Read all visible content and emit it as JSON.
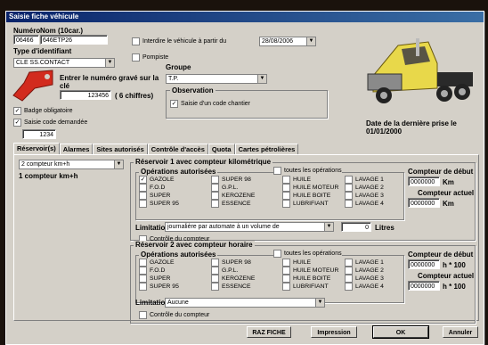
{
  "window": {
    "title": "Saisie fiche véhicule"
  },
  "header": {
    "numero_label": "Numéro",
    "numero_value": "06466",
    "nom_label": "Nom (10car.)",
    "nom_value": "646ETP26",
    "type_ident_label": "Type d'identifiant",
    "type_ident_value": "CLE SS.CONTACT",
    "code_label": "Entrer le numéro gravé sur la clé",
    "code_value": "123456",
    "code_hint": "( 6 chiffres)",
    "badge_label": "Badge obligatoire",
    "badge_checked": true,
    "saisie_code_label": "Saisie code demandée",
    "saisie_code_checked": true,
    "saisie_code_value": "1234",
    "interdire_label": "Interdire le véhicule à partir du",
    "interdire_checked": false,
    "interdire_date": "28/08/2006",
    "pompiste_label": "Pompiste",
    "pompiste_checked": false,
    "groupe_label": "Groupe",
    "groupe_value": "T.P.",
    "observation_label": "Observation",
    "obs_chantier_label": "Saisie d'un code chantier",
    "obs_chantier_checked": true,
    "last_photo_label": "Date de la dernière prise le",
    "last_photo_date": "01/01/2000"
  },
  "tabs": [
    "Réservoir(s)",
    "Alarmes",
    "Sites autorisés",
    "Contrôle d'accès",
    "Quota",
    "Cartes pétrolières"
  ],
  "reservoir_panel": {
    "compteur_select": "2 compteur km+h",
    "compteur_summary": "1 compteur km+h"
  },
  "reservoir1": {
    "title": "Réservoir 1 avec compteur kilométrique",
    "ops_label": "Opérations autorisées",
    "toutes_label": "toutes les opérations",
    "operations": [
      {
        "label": "GAZOLE",
        "checked": true
      },
      {
        "label": "SUPER 98",
        "checked": false
      },
      {
        "label": "HUILE",
        "checked": false
      },
      {
        "label": "LAVAGE 1",
        "checked": false
      },
      {
        "label": "F.O.D",
        "checked": false
      },
      {
        "label": "G.P.L.",
        "checked": false
      },
      {
        "label": "HUILE MOTEUR",
        "checked": false
      },
      {
        "label": "LAVAGE 2",
        "checked": false
      },
      {
        "label": "SUPER",
        "checked": false
      },
      {
        "label": "KEROZENE",
        "checked": false
      },
      {
        "label": "HUILE BOITE",
        "checked": false
      },
      {
        "label": "LAVAGE 3",
        "checked": false
      },
      {
        "label": "SUPER 95",
        "checked": false
      },
      {
        "label": "ESSENCE",
        "checked": false
      },
      {
        "label": "LUBRIFIANT",
        "checked": false
      },
      {
        "label": "LAVAGE 4",
        "checked": false
      }
    ],
    "compteur_debut_label": "Compteur de début",
    "compteur_debut_value": "0000000",
    "compteur_debut_unit": "Km",
    "compteur_actuel_label": "Compteur actuel",
    "compteur_actuel_value": "0000000",
    "compteur_actuel_unit": "Km",
    "limitation_label": "Limitation",
    "limitation_value": "journalière par automate  à un volume de",
    "limitation_qty": "0",
    "limitation_unit": "Litres",
    "controle_label": "Contrôle du compteur"
  },
  "reservoir2": {
    "title": "Réservoir 2 avec compteur horaire",
    "ops_label": "Opérations autorisées",
    "toutes_label": "toutes les opérations",
    "operations": [
      {
        "label": "GAZOLE",
        "checked": false
      },
      {
        "label": "SUPER 98",
        "checked": false
      },
      {
        "label": "HUILE",
        "checked": false
      },
      {
        "label": "LAVAGE 1",
        "checked": false
      },
      {
        "label": "F.O.D",
        "checked": false
      },
      {
        "label": "G.P.L.",
        "checked": false
      },
      {
        "label": "HUILE MOTEUR",
        "checked": false
      },
      {
        "label": "LAVAGE 2",
        "checked": false
      },
      {
        "label": "SUPER",
        "checked": false
      },
      {
        "label": "KEROZENE",
        "checked": false
      },
      {
        "label": "HUILE BOITE",
        "checked": false
      },
      {
        "label": "LAVAGE 3",
        "checked": false
      },
      {
        "label": "SUPER 95",
        "checked": false
      },
      {
        "label": "ESSENCE",
        "checked": false
      },
      {
        "label": "LUBRIFIANT",
        "checked": false
      },
      {
        "label": "LAVAGE 4",
        "checked": false
      }
    ],
    "compteur_debut_label": "Compteur de début",
    "compteur_debut_value": "0000000",
    "compteur_debut_unit": "h * 100",
    "compteur_actuel_label": "Compteur actuel",
    "compteur_actuel_value": "0000000",
    "compteur_actuel_unit": "h * 100",
    "limitation_label": "Limitation",
    "limitation_value": "Aucune",
    "controle_label": "Contrôle du compteur"
  },
  "buttons": {
    "raz": "RAZ FICHE",
    "impression": "Impression",
    "ok": "OK",
    "annuler": "Annuler"
  },
  "colors": {
    "titlebar": "#0a246a",
    "window_bg": "#d4d0c8",
    "key_tag": "#d22b1e",
    "truck": "#e8d84a"
  }
}
